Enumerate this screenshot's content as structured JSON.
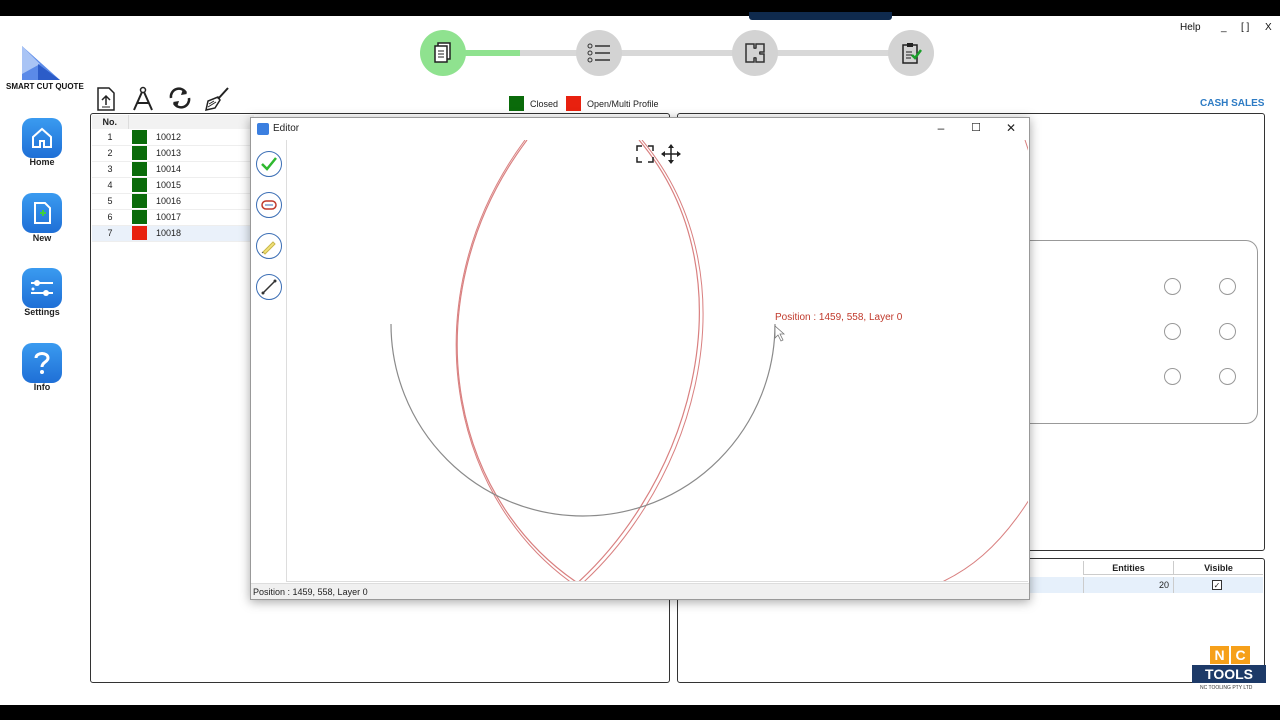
{
  "app": {
    "logo_text": "SMART CUT QUOTE",
    "window_controls": {
      "help": "Help",
      "minimize": "_",
      "maximize": "[ ]",
      "close": "X"
    }
  },
  "nav": [
    {
      "label": "Home",
      "icon": "home-icon"
    },
    {
      "label": "New",
      "icon": "new-document-icon"
    },
    {
      "label": "Settings",
      "icon": "settings-icon"
    },
    {
      "label": "Info",
      "icon": "question-icon"
    }
  ],
  "steps": [
    {
      "icon": "documents-icon",
      "active": true
    },
    {
      "icon": "checklist-icon",
      "active": false
    },
    {
      "icon": "puzzle-icon",
      "active": false
    },
    {
      "icon": "clipboard-check-icon",
      "active": false
    }
  ],
  "toolbar": [
    "upload-icon",
    "compass-icon",
    "refresh-icon",
    "broom-icon"
  ],
  "legend": {
    "closed_label": "Closed",
    "closed_color": "#0a6b0a",
    "open_label": "Open/Multi Profile",
    "open_color": "#e8210f"
  },
  "customer": "CASH SALES",
  "parts_table": {
    "header_no": "No.",
    "rows": [
      {
        "no": "1",
        "status": "closed",
        "id": "10012"
      },
      {
        "no": "2",
        "status": "closed",
        "id": "10013"
      },
      {
        "no": "3",
        "status": "closed",
        "id": "10014"
      },
      {
        "no": "4",
        "status": "closed",
        "id": "10015"
      },
      {
        "no": "5",
        "status": "closed",
        "id": "10016"
      },
      {
        "no": "6",
        "status": "closed",
        "id": "10017"
      },
      {
        "no": "7",
        "status": "open",
        "id": "10018"
      }
    ]
  },
  "layers": {
    "entities_header": "Entities",
    "visible_header": "Visible",
    "entities_value": "20",
    "visible_checked": true
  },
  "editor": {
    "title": "Editor",
    "controls": {
      "minimize": "–",
      "maximize": "☐",
      "close": "✕"
    },
    "tools": [
      "check-icon",
      "profile-loop-icon",
      "pencil-icon",
      "line-icon"
    ],
    "cursor_readout": "Position : 1459, 558, Layer 0",
    "status_text": "Position : 1459, 558, Layer 0"
  },
  "brand": {
    "nc_left": "N",
    "nc_right": "C",
    "tools": "TOOLS",
    "sub": "NC TOOLING PTY LTD"
  }
}
